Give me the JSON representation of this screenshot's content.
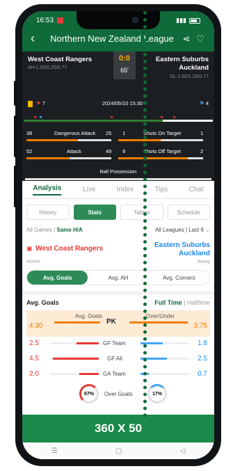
{
  "status": {
    "time": "16:53",
    "signal": "ऽil",
    "wifi": "≈"
  },
  "header": {
    "title": "Northern New Zealand League"
  },
  "match": {
    "home": "West Coast Rangers",
    "away_line1": "Eastern Suburbs",
    "away_line2": "Auckland",
    "home_odds": "AH:1.02/0.25/0.77",
    "away_odds": "GL:1.02/1.25/0.77",
    "score": "0:0",
    "minute": "65'",
    "datetime": "2024/05/10 15:30",
    "home_cards": "7",
    "away_cards": "4",
    "stats": [
      {
        "home": "38",
        "label": "Dangerous Attack",
        "away": "25"
      },
      {
        "home": "52",
        "label": "Attack",
        "away": "49"
      }
    ],
    "stats_right": [
      {
        "home": "1",
        "label": "Shots On Target",
        "away": "1"
      },
      {
        "home": "9",
        "label": "Shots Off Target",
        "away": "2"
      }
    ],
    "possession_label": "Ball Possession"
  },
  "tabs": [
    "Analysis",
    "Live",
    "Index",
    "Tips",
    "Chat"
  ],
  "subtabs": [
    "History",
    "Stats",
    "Tables",
    "Schedule"
  ],
  "filter": {
    "all": "All Games",
    "sep": "|",
    "same": "Same H/A",
    "right": "All Leagues | Last 6"
  },
  "teams2": {
    "home": "West Coast Rangers",
    "away_line1": "Eastern Suburbs",
    "away_line2": "Auckland",
    "home_tag": "Home",
    "away_tag": "Away"
  },
  "segment": [
    "Avg. Goals",
    "Avg. AH",
    "Avg. Corners"
  ],
  "avg": {
    "title": "Avg. Goals",
    "full_time": "Full Time",
    "half_time": "Halftime",
    "pk_left_label": "Avg. Goals",
    "pk_right_label": "Over/Under",
    "pk": "PK",
    "pk_left": "4.30",
    "pk_right": "3.75",
    "rows": [
      {
        "label": "GF Team",
        "left": "2.5",
        "right": "1.8"
      },
      {
        "label": "GF All",
        "left": "4.5",
        "right": "2.5"
      },
      {
        "label": "GA Team",
        "left": "2.0",
        "right": "0.7"
      }
    ],
    "over_left": "67%",
    "over_label": "Over Goals",
    "over_right": "17%"
  },
  "ad": {
    "text": "360 X 50"
  },
  "nav": {
    "menu": "☰",
    "home": "▢",
    "back": "◁"
  }
}
